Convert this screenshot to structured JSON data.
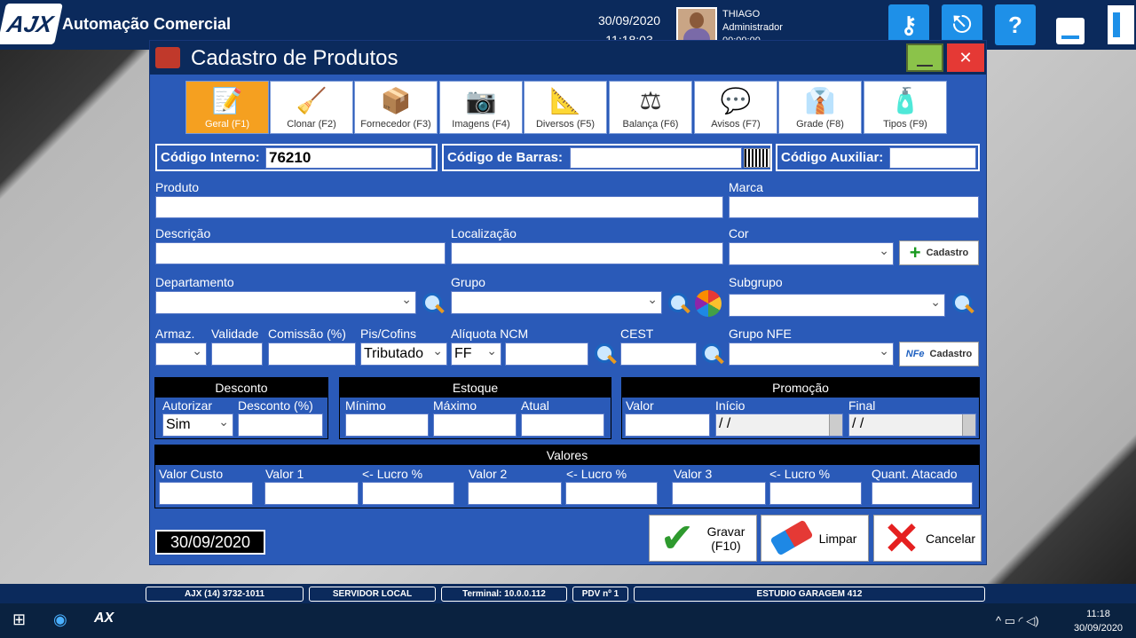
{
  "topbar": {
    "logo": "AJX",
    "title": "Automação Comercial",
    "date": "30/09/2020",
    "time": "11:18:03",
    "user_name": "THIAGO",
    "user_role": "Administrador",
    "user_extra": "00:00:00"
  },
  "topbuttons": [
    {
      "icon": "key-icon",
      "glyph": "⚷"
    },
    {
      "icon": "network-icon",
      "glyph": "⎋"
    },
    {
      "icon": "help-icon",
      "glyph": "?"
    }
  ],
  "dialog": {
    "title": "Cadastro de Produtos",
    "close_glyph": "✕"
  },
  "tabs": [
    {
      "label": "Geral (F1)",
      "icon": "📝"
    },
    {
      "label": "Clonar (F2)",
      "icon": "🧹"
    },
    {
      "label": "Fornecedor (F3)",
      "icon": "📦"
    },
    {
      "label": "Imagens (F4)",
      "icon": "📷"
    },
    {
      "label": "Diversos (F5)",
      "icon": "📐"
    },
    {
      "label": "Balança (F6)",
      "icon": "⚖"
    },
    {
      "label": "Avisos (F7)",
      "icon": "💬"
    },
    {
      "label": "Grade (F8)",
      "icon": "👔"
    },
    {
      "label": "Tipos (F9)",
      "icon": "🧴"
    }
  ],
  "codes": {
    "interno_label": "Código Interno:",
    "interno_value": "76210",
    "barras_label": "Código de Barras:",
    "barras_value": "",
    "auxiliar_label": "Código Auxiliar:",
    "auxiliar_value": ""
  },
  "fields": {
    "produto": "Produto",
    "marca": "Marca",
    "descricao": "Descrição",
    "localizacao": "Localização",
    "cor": "Cor",
    "cadastro": "Cadastro",
    "departamento": "Departamento",
    "grupo": "Grupo",
    "subgrupo": "Subgrupo",
    "armaz": "Armaz.",
    "validade": "Validade",
    "comissao": "Comissão (%)",
    "piscofins": "Pis/Cofins",
    "piscofins_value": "Tributado",
    "aliquota": "Alíquota NCM",
    "aliquota_value": "FF",
    "cest": "CEST",
    "grupo_nfe": "Grupo NFE",
    "nfe_logo": "NFe"
  },
  "desconto": {
    "title": "Desconto",
    "autorizar": "Autorizar",
    "autorizar_value": "Sim",
    "desconto_pct": "Desconto (%)"
  },
  "estoque": {
    "title": "Estoque",
    "minimo": "Mínimo",
    "maximo": "Máximo",
    "atual": "Atual"
  },
  "promocao": {
    "title": "Promoção",
    "valor": "Valor",
    "inicio": "Início",
    "inicio_value": " /  /",
    "final": "Final",
    "final_value": " /  /"
  },
  "valores": {
    "title": "Valores",
    "custo": "Valor Custo",
    "v1": "Valor 1",
    "lucro": "<- Lucro %",
    "v2": "Valor 2",
    "v3": "Valor 3",
    "atacado": "Quant. Atacado"
  },
  "footer": {
    "date": "30/09/2020",
    "gravar": "Gravar\n(F10)",
    "limpar": "Limpar",
    "cancelar": "Cancelar"
  },
  "statusbar": [
    "AJX (14) 3732-1011",
    "SERVIDOR LOCAL",
    "Terminal: 10.0.0.112",
    "PDV nº 1",
    "ESTUDIO GARAGEM 412"
  ],
  "taskbar": {
    "windows_icon": "⊞",
    "app1_icon": "◉",
    "app2": "AX",
    "tray": "^ ▭ ◜ ◁)",
    "time": "11:18",
    "date": "30/09/2020"
  }
}
